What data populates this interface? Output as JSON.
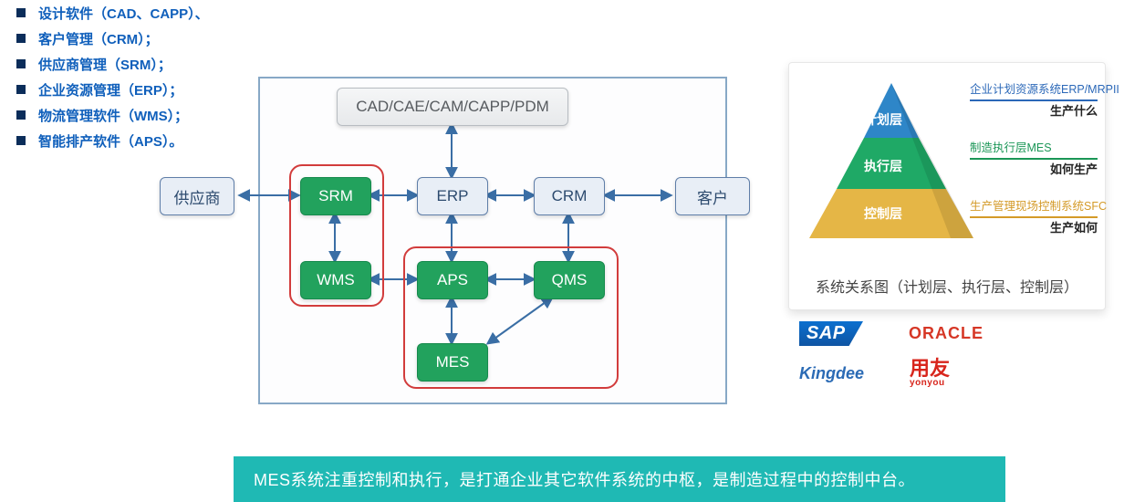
{
  "bullets": [
    "设计软件（CAD、CAPP）、",
    "客户管理（CRM）；",
    "供应商管理（SRM）；",
    "企业资源管理（ERP）；",
    "物流管理软件（WMS）；",
    "智能排产软件（APS）。"
  ],
  "diagram": {
    "top": "CAD/CAE/CAM/CAPP/PDM",
    "left_out": "供应商",
    "right_out": "客户",
    "srm": "SRM",
    "wms": "WMS",
    "erp": "ERP",
    "crm": "CRM",
    "aps": "APS",
    "qms": "QMS",
    "mes": "MES"
  },
  "pyramid": {
    "l1": "计划层",
    "l2": "执行层",
    "l3": "控制层",
    "r1a": "企业计划资源系统ERP/MRPII",
    "r1b": "生产什么",
    "r2a": "制造执行层MES",
    "r2b": "如何生产",
    "r3a": "生产管理现场控制系统SFC",
    "r3b": "生产如何",
    "caption": "系统关系图（计划层、执行层、控制层）"
  },
  "logos": {
    "sap": "SAP",
    "oracle": "ORACLE",
    "kingdee": "Kingdee",
    "yonyou_cn": "用友",
    "yonyou_en": "yonyou"
  },
  "banner": "MES系统注重控制和执行，是打通企业其它软件系统的中枢，是制造过程中的控制中台。"
}
